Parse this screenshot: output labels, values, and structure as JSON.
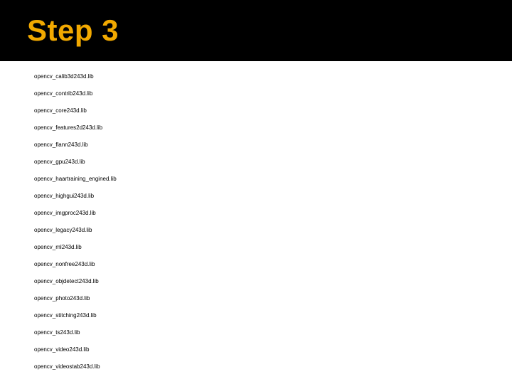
{
  "header": {
    "title": "Step 3"
  },
  "libs": [
    "opencv_calib3d243d.lib",
    "opencv_contrib243d.lib",
    "opencv_core243d.lib",
    "opencv_features2d243d.lib",
    "opencv_flann243d.lib",
    "opencv_gpu243d.lib",
    "opencv_haartraining_engined.lib",
    "opencv_highgui243d.lib",
    "opencv_imgproc243d.lib",
    "opencv_legacy243d.lib",
    "opencv_ml243d.lib",
    "opencv_nonfree243d.lib",
    "opencv_objdetect243d.lib",
    "opencv_photo243d.lib",
    "opencv_stitching243d.lib",
    "opencv_ts243d.lib",
    "opencv_video243d.lib",
    "opencv_videostab243d.lib"
  ]
}
